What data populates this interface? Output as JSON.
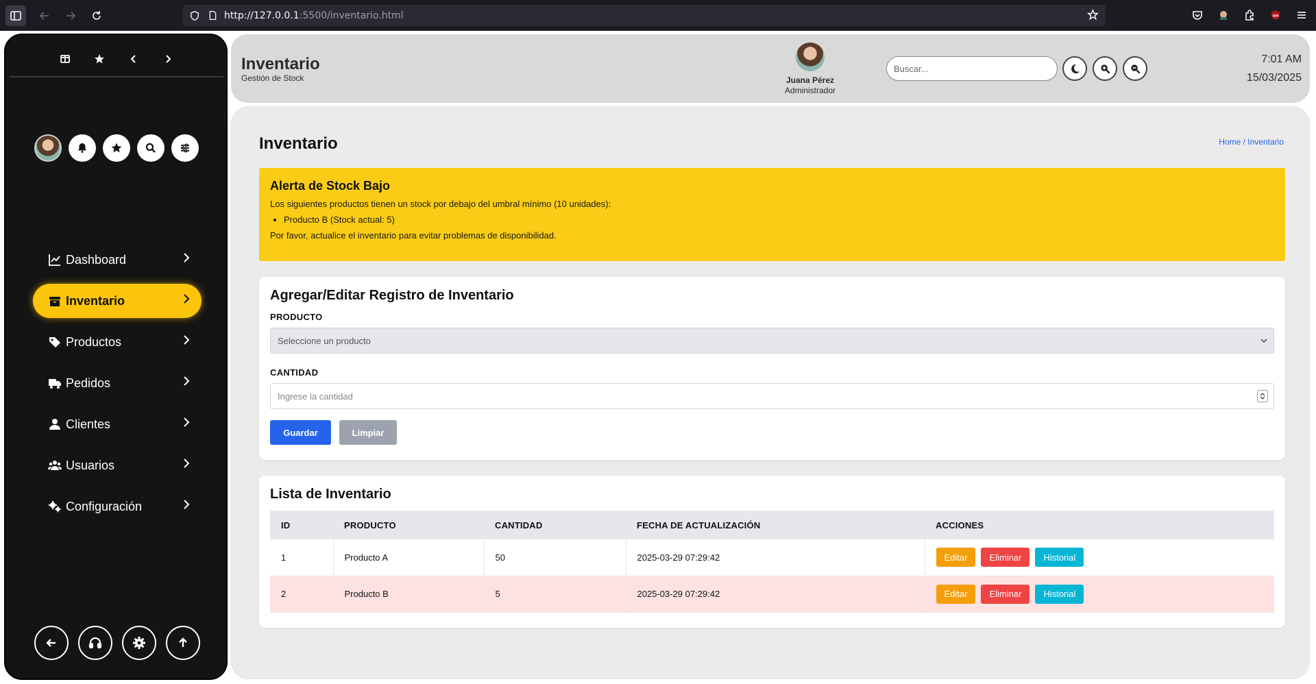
{
  "browser": {
    "url_host": "http://127.0.0.1",
    "url_rest": ":5500/inventario.html"
  },
  "header": {
    "title": "Inventario",
    "subtitle": "Gestión de Stock",
    "user_name": "Juana Pérez",
    "user_role": "Administrador",
    "search_placeholder": "Buscar...",
    "time": "7:01 AM",
    "date": "15/03/2025"
  },
  "sidebar": {
    "items": [
      {
        "label": "Dashboard",
        "icon": "chart-line-icon"
      },
      {
        "label": "Inventario",
        "icon": "box-icon",
        "active": true
      },
      {
        "label": "Productos",
        "icon": "tag-icon"
      },
      {
        "label": "Pedidos",
        "icon": "truck-icon"
      },
      {
        "label": "Clientes",
        "icon": "user-icon"
      },
      {
        "label": "Usuarios",
        "icon": "users-icon"
      },
      {
        "label": "Configuración",
        "icon": "gears-icon"
      }
    ],
    "accent": "#fcc40a"
  },
  "page": {
    "title": "Inventario",
    "breadcrumb": "Home / Inventario"
  },
  "alert": {
    "title": "Alerta de Stock Bajo",
    "message": "Los siguientes productos tienen un stock por debajo del umbral mínimo (10 unidades):",
    "items": [
      "Producto B (Stock actual: 5)"
    ],
    "footer": "Por favor, actualice el inventario para evitar problemas de disponibilidad."
  },
  "form": {
    "title": "Agregar/Editar Registro de Inventario",
    "product_label": "PRODUCTO",
    "product_placeholder": "Seleccione un producto",
    "quantity_label": "CANTIDAD",
    "quantity_placeholder": "Ingrese la cantidad",
    "save_label": "Guardar",
    "clear_label": "Limpiar"
  },
  "table": {
    "title": "Lista de Inventario",
    "columns": [
      "ID",
      "PRODUCTO",
      "CANTIDAD",
      "FECHA DE ACTUALIZACIÓN",
      "ACCIONES"
    ],
    "rows": [
      {
        "id": "1",
        "product": "Producto A",
        "quantity": "50",
        "updated": "2025-03-29 07:29:42"
      },
      {
        "id": "2",
        "product": "Producto B",
        "quantity": "5",
        "updated": "2025-03-29 07:29:42"
      }
    ],
    "actions": {
      "edit": "Editar",
      "delete": "Eliminar",
      "history": "Historial"
    }
  }
}
